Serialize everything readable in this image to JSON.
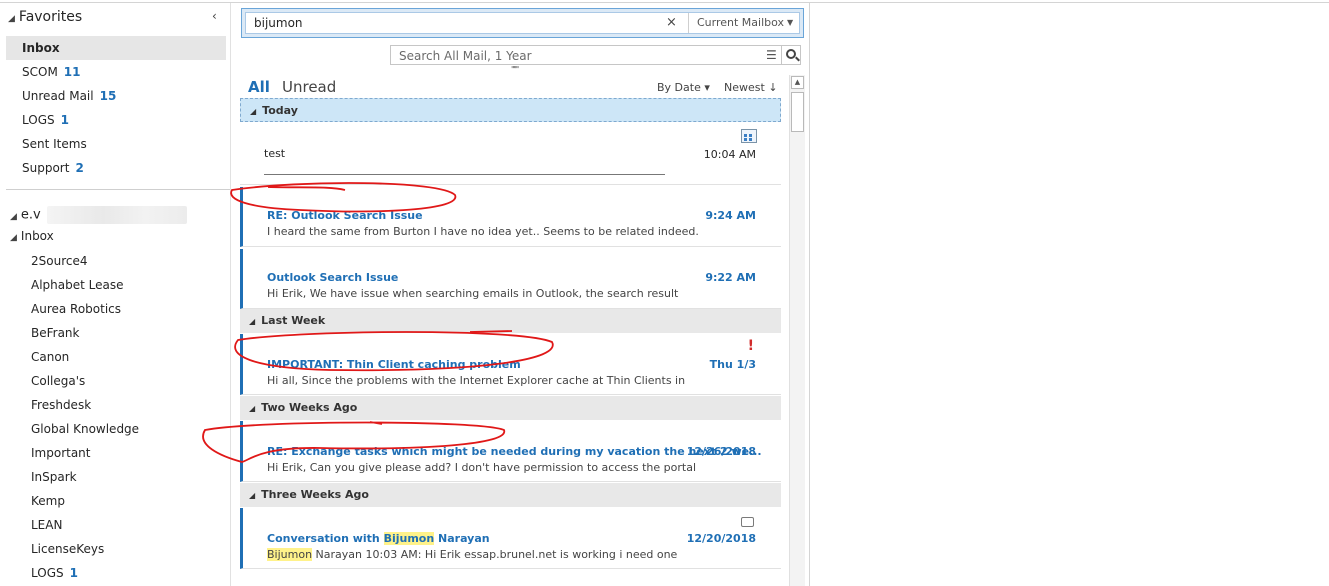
{
  "nav": {
    "favorites_label": "Favorites",
    "collapse_glyph": "‹",
    "favorites": [
      {
        "label": "Inbox",
        "count": "",
        "selected": true
      },
      {
        "label": "SCOM",
        "count": "11"
      },
      {
        "label": "Unread Mail",
        "count": "15"
      },
      {
        "label": "LOGS",
        "count": "1"
      },
      {
        "label": "Sent Items",
        "count": ""
      },
      {
        "label": "Support",
        "count": "2"
      }
    ],
    "account_label": "e.v",
    "inbox_label": "Inbox",
    "folders": [
      {
        "label": "2Source4",
        "count": ""
      },
      {
        "label": "Alphabet Lease",
        "count": ""
      },
      {
        "label": "Aurea Robotics",
        "count": ""
      },
      {
        "label": "BeFrank",
        "count": ""
      },
      {
        "label": "Canon",
        "count": ""
      },
      {
        "label": "Collega's",
        "count": ""
      },
      {
        "label": "Freshdesk",
        "count": ""
      },
      {
        "label": "Global Knowledge",
        "count": ""
      },
      {
        "label": "Important",
        "count": ""
      },
      {
        "label": "InSpark",
        "count": ""
      },
      {
        "label": "Kemp",
        "count": ""
      },
      {
        "label": "LEAN",
        "count": ""
      },
      {
        "label": "LicenseKeys",
        "count": ""
      },
      {
        "label": "LOGS",
        "count": "1"
      }
    ]
  },
  "search": {
    "query": "bijumon",
    "clear_glyph": "×",
    "scope": "Current Mailbox",
    "secondary_placeholder": "Search All Mail, 1 Year"
  },
  "list": {
    "tab_all": "All",
    "tab_unread": "Unread",
    "sort_by": "By Date",
    "order": "Newest",
    "groups": {
      "today": "Today",
      "last_week": "Last Week",
      "two_weeks": "Two Weeks Ago",
      "three_weeks": "Three Weeks Ago"
    },
    "messages": {
      "m1": {
        "subject": "test",
        "time": "10:04 AM"
      },
      "m2": {
        "subject": "RE: Outlook Search Issue",
        "time": "9:24 AM",
        "preview": "I heard the same from Burton  I have no idea yet..  Seems to be related indeed."
      },
      "m3": {
        "subject": "Outlook Search Issue",
        "time": "9:22 AM",
        "preview": "Hi Erik,  We have issue when searching emails in Outlook, the search result"
      },
      "m4": {
        "subject": "IMPORTANT: Thin Client caching problem",
        "time": "Thu 1/3",
        "preview": "Hi all,  Since the problems with the Internet Explorer cache at Thin Clients in",
        "flag": "!"
      },
      "m5": {
        "subject": "RE: Exchange tasks which might be needed during my vacation the next 2 we...",
        "time": "12/26/2018",
        "preview": "Hi Erik,  Can you give please add?  I don't have permission to access the portal"
      },
      "m6": {
        "subject_pre": "Conversation with ",
        "subject_hl": "Bijumon",
        "subject_post": " Narayan",
        "time": "12/20/2018",
        "preview_hl": "Bijumon",
        "preview_post": " Narayan 10:03 AM:  Hi Erik  essap.brunel.net is working  i need one"
      }
    }
  },
  "colors": {
    "accent": "#1f6fb5",
    "annotation": "#e01818",
    "flag": "#d12b2b",
    "highlight": "#fff28a"
  }
}
